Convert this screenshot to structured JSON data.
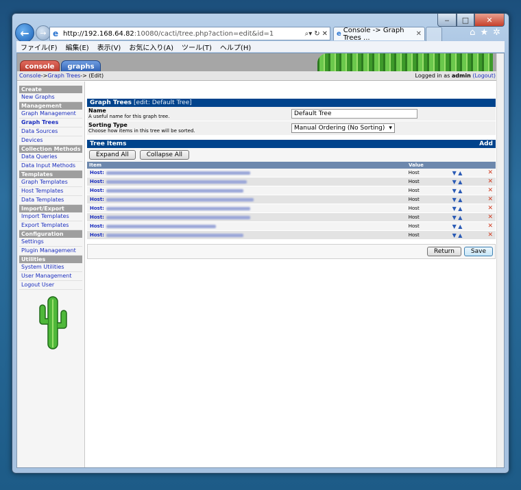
{
  "browser": {
    "url_host": "http://192.168.64.82",
    "url_rest": ":10080/cacti/tree.php?action=edit&id=1",
    "tab_title": "Console -> Graph Trees ...",
    "menu": [
      "ファイル(F)",
      "編集(E)",
      "表示(V)",
      "お気に入り(A)",
      "ツール(T)",
      "ヘルプ(H)"
    ]
  },
  "top_tabs": {
    "console": "console",
    "graphs": "graphs"
  },
  "breadcrumb": {
    "console": "Console",
    "sep1": " -> ",
    "graph_trees": "Graph Trees",
    "sep2": " -> (Edit)"
  },
  "login": {
    "prefix": "Logged in as ",
    "user": "admin",
    "logout": "(Logout)"
  },
  "sidebar": {
    "create_header": "Create",
    "new_graphs": "New Graphs",
    "management_header": "Management",
    "graph_management": "Graph Management",
    "graph_trees": "Graph Trees",
    "data_sources": "Data Sources",
    "devices": "Devices",
    "collection_header": "Collection Methods",
    "data_queries": "Data Queries",
    "data_input_methods": "Data Input Methods",
    "templates_header": "Templates",
    "graph_templates": "Graph Templates",
    "host_templates": "Host Templates",
    "data_templates": "Data Templates",
    "import_export_header": "Import/Export",
    "import_templates": "Import Templates",
    "export_templates": "Export Templates",
    "configuration_header": "Configuration",
    "settings": "Settings",
    "plugin_management": "Plugin Management",
    "utilities_header": "Utilities",
    "system_utilities": "System Utilities",
    "user_management": "User Management",
    "logout_user": "Logout User"
  },
  "form": {
    "title": "Graph Trees",
    "title_sub": "[edit: Default Tree]",
    "name_label": "Name",
    "name_desc": "A useful name for this graph tree.",
    "name_value": "Default Tree",
    "sort_label": "Sorting Type",
    "sort_desc": "Choose how items in this tree will be sorted.",
    "sort_value": "Manual Ordering (No Sorting)"
  },
  "tree": {
    "title": "Tree Items",
    "add": "Add",
    "expand": "Expand All",
    "collapse": "Collapse All",
    "col_item": "Item",
    "col_value": "Value",
    "rows": [
      {
        "prefix": "Host:",
        "value": "Host"
      },
      {
        "prefix": "Host:",
        "value": "Host"
      },
      {
        "prefix": "Host:",
        "value": "Host"
      },
      {
        "prefix": "Host:",
        "value": "Host"
      },
      {
        "prefix": "Host:",
        "value": "Host"
      },
      {
        "prefix": "Host:",
        "value": "Host"
      },
      {
        "prefix": "Host:",
        "value": "Host"
      },
      {
        "prefix": "Host:",
        "value": "Host"
      }
    ]
  },
  "buttons": {
    "return": "Return",
    "save": "Save"
  },
  "icons": {
    "move_down": "arrow-down-icon",
    "move_up": "arrow-up-icon",
    "delete": "delete-x-icon"
  }
}
